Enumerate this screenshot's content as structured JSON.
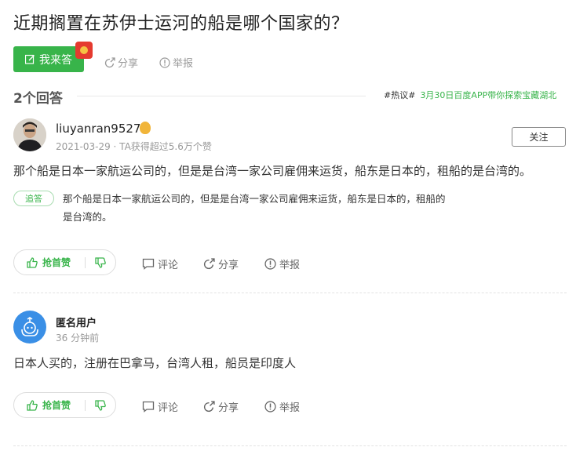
{
  "question": {
    "title": "近期搁置在苏伊士运河的船是哪个国家的？",
    "answer_button": "我来答",
    "share_label": "分享",
    "report_label": "举报"
  },
  "answers_header": {
    "count_label": "2个回答",
    "hot_tag": "#热议#",
    "hot_link": "3月30日百度APP带你探索宝藏湖北"
  },
  "answers": [
    {
      "username": "liuyanran9527",
      "meta": "2021-03-29 · TA获得超过5.6万个赞",
      "follow_label": "关注",
      "text": "那个船是日本一家航运公司的，但是是台湾一家公司雇佣来运货，船东是日本的，租船的是台湾的。",
      "followup_badge": "追答",
      "followup_text": "那个船是日本一家航运公司的，但是是台湾一家公司雇佣来运货，船东是日本的，租船的是台湾的。",
      "vote_label": "抢首赞",
      "comment_label": "评论",
      "share_label": "分享",
      "report_label": "举报"
    },
    {
      "username": "匿名用户",
      "meta": "36 分钟前",
      "text": "日本人买的，注册在巴拿马，台湾人租，船员是印度人",
      "vote_label": "抢首赞",
      "comment_label": "评论",
      "share_label": "分享",
      "report_label": "举报"
    }
  ],
  "colors": {
    "accent_green": "#38b44a",
    "muted_gray": "#999999",
    "anon_blue": "#3a8fe6",
    "redpack": "#e53a2f"
  },
  "icons": [
    "pen-icon",
    "red-packet-icon",
    "share-icon",
    "report-icon",
    "thumb-up-icon",
    "thumb-down-icon",
    "comment-icon",
    "medal-icon",
    "anonymous-avatar-icon"
  ]
}
